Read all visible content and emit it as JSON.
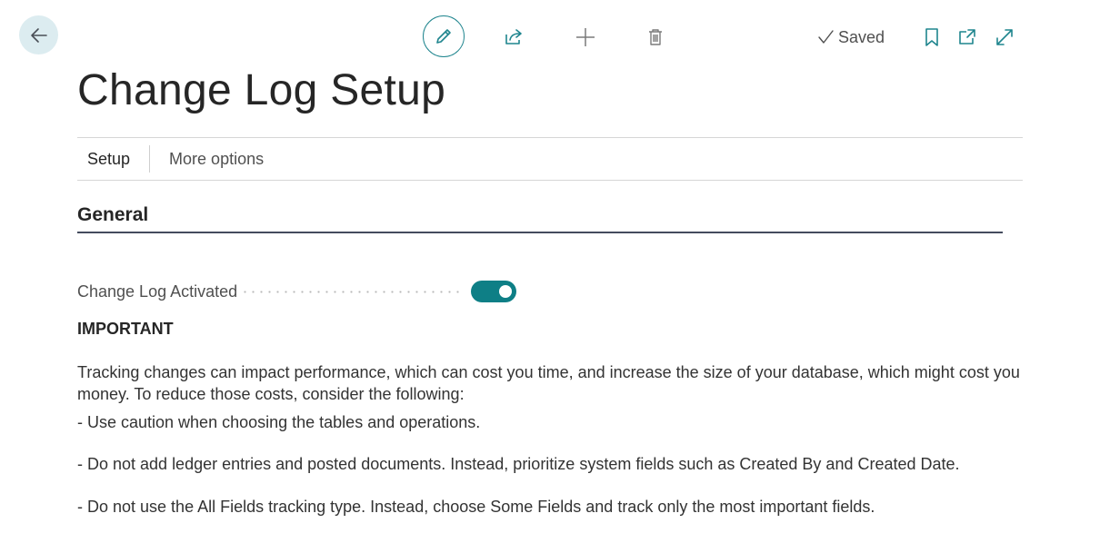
{
  "toolbar": {
    "saved_label": "Saved"
  },
  "page": {
    "title": "Change Log Setup"
  },
  "actions": {
    "setup": "Setup",
    "more_options": "More options"
  },
  "section": {
    "title": "General"
  },
  "fields": {
    "change_log_activated": {
      "label": "Change Log Activated",
      "value": true
    }
  },
  "notice": {
    "heading": "IMPORTANT",
    "paragraph": "Tracking changes can impact performance, which can cost you time, and increase the size of your database, which might cost you money. To reduce those costs, consider the following:",
    "bullets": [
      "- Use caution when choosing the tables and operations.",
      "- Do not add ledger entries and posted documents. Instead, prioritize system fields such as Created By and Created Date.",
      "- Do not use the All Fields tracking type. Instead, choose Some Fields and track only the most important fields."
    ]
  },
  "colors": {
    "accent": "#0e7f86",
    "back_button_bg": "#dcecf0",
    "section_rule": "#444c5e"
  },
  "icons": {
    "back": "arrow-left-icon",
    "edit": "pencil-icon",
    "share": "share-icon",
    "new": "plus-icon",
    "delete": "trash-icon",
    "saved": "checkmark-icon",
    "bookmark": "bookmark-icon",
    "open_new_window": "open-new-window-icon",
    "expand": "expand-icon"
  }
}
